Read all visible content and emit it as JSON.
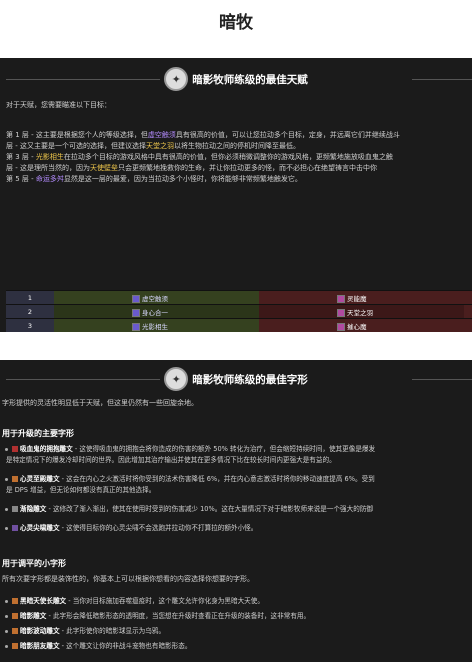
{
  "page": {
    "title": "暗牧"
  },
  "talents": {
    "header": "暗影牧师练级的最佳天赋",
    "intro": "对于天赋，您需要瞄准以下目标：",
    "lines": [
      {
        "pre": "第 1 层 - 这主要是根据您个人的等级选择，但",
        "hl": "虚空触须",
        "post": "具有很高的价值，可以让您拉动多个目标，定身，并远离它们并继续战斗",
        "color": "p"
      },
      {
        "pre": "层 - 这又主要是一个可选的选择，但建议选择",
        "hl": "天堂之羽",
        "post": "以将生物拉动之间的停机时间降至最低。",
        "color": "y"
      },
      {
        "pre": "第 3 层 - ",
        "hl": "光影相生",
        "post": "在拉动多个目标的游戏风格中具有很高的价值，但你必须稍微调整你的游戏风格，更频繁地施放吸血鬼之触",
        "color": "y"
      },
      {
        "pre": "层 - 这是理所当然的，因为",
        "hl": "天使壁垒",
        "post": "只会更频繁地挽救你的生命，并让你拉动更多的怪，而不必担心在绝望祷言中击中你",
        "color": "y"
      },
      {
        "pre": "第 5 层 - ",
        "hl": "命运多舛",
        "post": "显然是这一层的最爱，因为当拉动多个小怪时，你将能够非常频繁地触发它。",
        "color": "p"
      }
    ],
    "table": [
      {
        "tier": "1",
        "a": "虚空触须",
        "b": "灵能魔"
      },
      {
        "tier": "2",
        "a": "身心合一",
        "b": "天堂之羽"
      },
      {
        "tier": "3",
        "a": "光影相生",
        "b": "摧心魔"
      },
      {
        "tier": "4",
        "a": "绝望祷言",
        "b": "幽灵伪装"
      },
      {
        "tier": "5",
        "a": "命运多舛",
        "b": "能量灌注"
      }
    ]
  },
  "glyphs": {
    "header": "暗影牧师练级的最佳字形",
    "intro": "字形提供的灵活性明显低于天赋，但这里仍然有一些回旋余地。",
    "major_title": "用于升级的主要字形",
    "major": [
      {
        "name": "吸血鬼的拥抱雕文",
        "l1": " - 这使得吸血鬼的拥抱会将你造成的伤害的额外 50% 转化为治疗，但会缩短持续时间，使其更像是爆发",
        "l2": "是特定情况下的爆发冷却时间的世界。因此增加其治疗输出并使其在更多情况下比在较长时间内更强大是有益的。",
        "color": "#b03030"
      },
      {
        "name": "心灵至殿雕文",
        "l1": " - 这会在内心之火激活时将你受到的法术伤害降低 6%，并在内心意志激活时将你的移动速度提高 6%。受到",
        "l2": "是 DPS 增益，但无论如何都没有真正的其他选择。",
        "color": "#c07030"
      },
      {
        "name": "渐隐雕文",
        "l1": " - 这修改了渐入渐出，使其在使用时受到的伤害减少 10%。这在大量情况下对于暗影牧师来说是一个强大的防御",
        "l2": "",
        "color": "#888888"
      },
      {
        "name": "心灵尖啸雕文",
        "l1": " - 这使得目标你的心灵尖啸不会选跑并拉动你不打算拉的额外小怪。",
        "l2": "",
        "color": "#7050a0"
      }
    ],
    "minor_title": "用于调平的小字形",
    "minor_intro": "所有次要字形都是装饰性的，你基本上可以根据你想看的内容选择你想要的字形。",
    "minor": [
      {
        "name": "黑暗天使长雕文",
        "rest": " - 当你对目标施加吞噬瘟疫时，这个雕文允许你化身为黑暗大天使。",
        "color": "#c07030"
      },
      {
        "name": "暗影雕文",
        "rest": " - 此字形会降低暗影形态的透明度，当您想在升级时查看正在升级的装备时，这非常有用。",
        "color": "#c07030"
      },
      {
        "name": "暗影波动雕文",
        "rest": " - 此字形使你的暗影球显示为乌鸦。",
        "color": "#c07030"
      },
      {
        "name": "暗影朋友雕文",
        "rest": " - 这个雕文让你的非战斗宠物也有暗影形态。",
        "color": "#c07030"
      }
    ]
  },
  "colors": {
    "panel_bg": "#1b1b1b",
    "highlight_purple": "#b48cff",
    "highlight_yellow": "#f2c94c"
  },
  "icons": {
    "talent_header": "priest-shadow-icon",
    "glyph_header": "priest-shadow-icon"
  }
}
